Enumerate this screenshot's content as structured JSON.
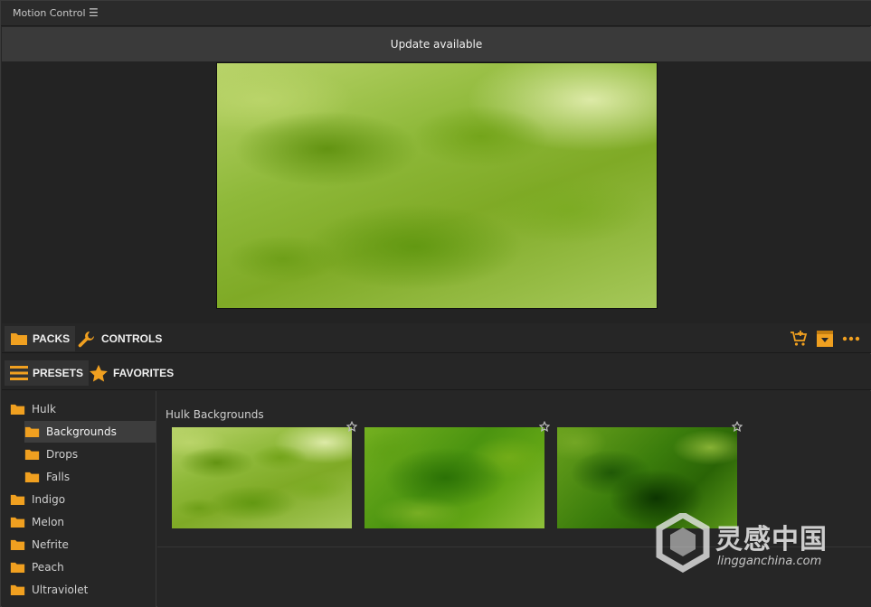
{
  "app": {
    "title": "Motion Control",
    "menu_icon": "hamburger-icon"
  },
  "update_banner": {
    "text": "Update available"
  },
  "preview": {
    "description_icon": "smoke-preview-image"
  },
  "main_tabs": [
    {
      "label": "PACKS",
      "icon": "folder-icon",
      "active": true
    },
    {
      "label": "CONTROLS",
      "icon": "wrench-icon",
      "active": false
    }
  ],
  "toolbar_icons": [
    "cart-add-icon",
    "download-box-icon",
    "more-icon"
  ],
  "sub_tabs": [
    {
      "label": "PRESETS",
      "icon": "list-icon",
      "active": true
    },
    {
      "label": "FAVORITES",
      "icon": "star-icon",
      "active": false
    }
  ],
  "tree": [
    {
      "label": "Hulk",
      "level": 0
    },
    {
      "label": "Backgrounds",
      "level": 1,
      "selected": true
    },
    {
      "label": "Drops",
      "level": 1
    },
    {
      "label": "Falls",
      "level": 1
    },
    {
      "label": "Indigo",
      "level": 0
    },
    {
      "label": "Melon",
      "level": 0
    },
    {
      "label": "Nefrite",
      "level": 0
    },
    {
      "label": "Peach",
      "level": 0
    },
    {
      "label": "Ultraviolet",
      "level": 0
    }
  ],
  "content": {
    "section_title": "Hulk Backgrounds",
    "thumbnails": [
      {
        "style": "smoke-a",
        "favorite_icon": "star-outline-icon"
      },
      {
        "style": "smoke-b",
        "favorite_icon": "star-outline-icon"
      },
      {
        "style": "smoke-c",
        "favorite_icon": "star-outline-icon"
      }
    ]
  },
  "watermark": {
    "cn": "灵感中国",
    "en": "lingganchina.com"
  },
  "colors": {
    "accent": "#f0a020",
    "background": "#262626",
    "banner": "#3a3a3a",
    "selected": "#3d3d3d"
  }
}
